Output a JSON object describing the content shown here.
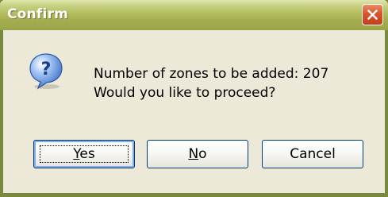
{
  "dialog": {
    "title": "Confirm",
    "icon": "question-icon",
    "message_line1": "Number of zones to be added: 207",
    "message_line2": "Would you like to proceed?",
    "buttons": {
      "yes": {
        "mnemonic": "Y",
        "rest": "es"
      },
      "no": {
        "mnemonic": "N",
        "rest": "o"
      },
      "cancel": "Cancel"
    },
    "default_button": "Yes"
  },
  "colors": {
    "titlebar": "#a3ad4e",
    "window_face": "#ece9d8",
    "close_button": "#d6562a",
    "button_border": "#003c74"
  }
}
